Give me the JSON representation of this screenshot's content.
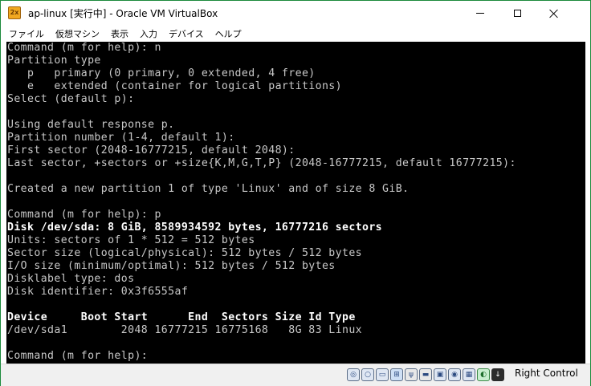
{
  "window": {
    "title": "ap-linux [実行中] - Oracle VM VirtualBox",
    "app_icon_text": "2x"
  },
  "menu": {
    "items": [
      "ファイル",
      "仮想マシン",
      "表示",
      "入力",
      "デバイス",
      "ヘルプ"
    ]
  },
  "console": {
    "lines": [
      {
        "text": "Command (m for help): n",
        "bright": false
      },
      {
        "text": "Partition type",
        "bright": false
      },
      {
        "text": "   p   primary (0 primary, 0 extended, 4 free)",
        "bright": false
      },
      {
        "text": "   e   extended (container for logical partitions)",
        "bright": false
      },
      {
        "text": "Select (default p):",
        "bright": false
      },
      {
        "text": "",
        "bright": false
      },
      {
        "text": "Using default response p.",
        "bright": false
      },
      {
        "text": "Partition number (1-4, default 1):",
        "bright": false
      },
      {
        "text": "First sector (2048-16777215, default 2048):",
        "bright": false
      },
      {
        "text": "Last sector, +sectors or +size{K,M,G,T,P} (2048-16777215, default 16777215):",
        "bright": false
      },
      {
        "text": "",
        "bright": false
      },
      {
        "text": "Created a new partition 1 of type 'Linux' and of size 8 GiB.",
        "bright": false
      },
      {
        "text": "",
        "bright": false
      },
      {
        "text": "Command (m for help): p",
        "bright": false
      },
      {
        "text": "Disk /dev/sda: 8 GiB, 8589934592 bytes, 16777216 sectors",
        "bright": true
      },
      {
        "text": "Units: sectors of 1 * 512 = 512 bytes",
        "bright": false
      },
      {
        "text": "Sector size (logical/physical): 512 bytes / 512 bytes",
        "bright": false
      },
      {
        "text": "I/O size (minimum/optimal): 512 bytes / 512 bytes",
        "bright": false
      },
      {
        "text": "Disklabel type: dos",
        "bright": false
      },
      {
        "text": "Disk identifier: 0x3f6555af",
        "bright": false
      },
      {
        "text": "",
        "bright": false
      },
      {
        "text": "Device     Boot Start      End  Sectors Size Id Type",
        "bright": true
      },
      {
        "text": "/dev/sda1        2048 16777215 16775168   8G 83 Linux",
        "bright": false
      },
      {
        "text": "",
        "bright": false
      },
      {
        "text": "Command (m for help):",
        "bright": false
      }
    ]
  },
  "statusbar": {
    "icons": [
      {
        "name": "optical-disk-icon",
        "glyph": "◎",
        "kind": ""
      },
      {
        "name": "cd-rom-icon",
        "glyph": "○",
        "kind": ""
      },
      {
        "name": "hard-disk-icon",
        "glyph": "▭",
        "kind": ""
      },
      {
        "name": "network-icon",
        "glyph": "⊞",
        "kind": "net"
      },
      {
        "name": "usb-icon",
        "glyph": "ψ",
        "kind": "usb"
      },
      {
        "name": "shared-folder-icon",
        "glyph": "▬",
        "kind": "usb"
      },
      {
        "name": "display-icon",
        "glyph": "▣",
        "kind": ""
      },
      {
        "name": "recording-icon",
        "glyph": "◉",
        "kind": ""
      },
      {
        "name": "cpu-icon",
        "glyph": "▦",
        "kind": ""
      },
      {
        "name": "mouse-integration-icon",
        "glyph": "◐",
        "kind": "green"
      },
      {
        "name": "keyboard-capture-icon",
        "glyph": "↓",
        "kind": "arrow"
      }
    ],
    "host_key": "Right Control"
  }
}
